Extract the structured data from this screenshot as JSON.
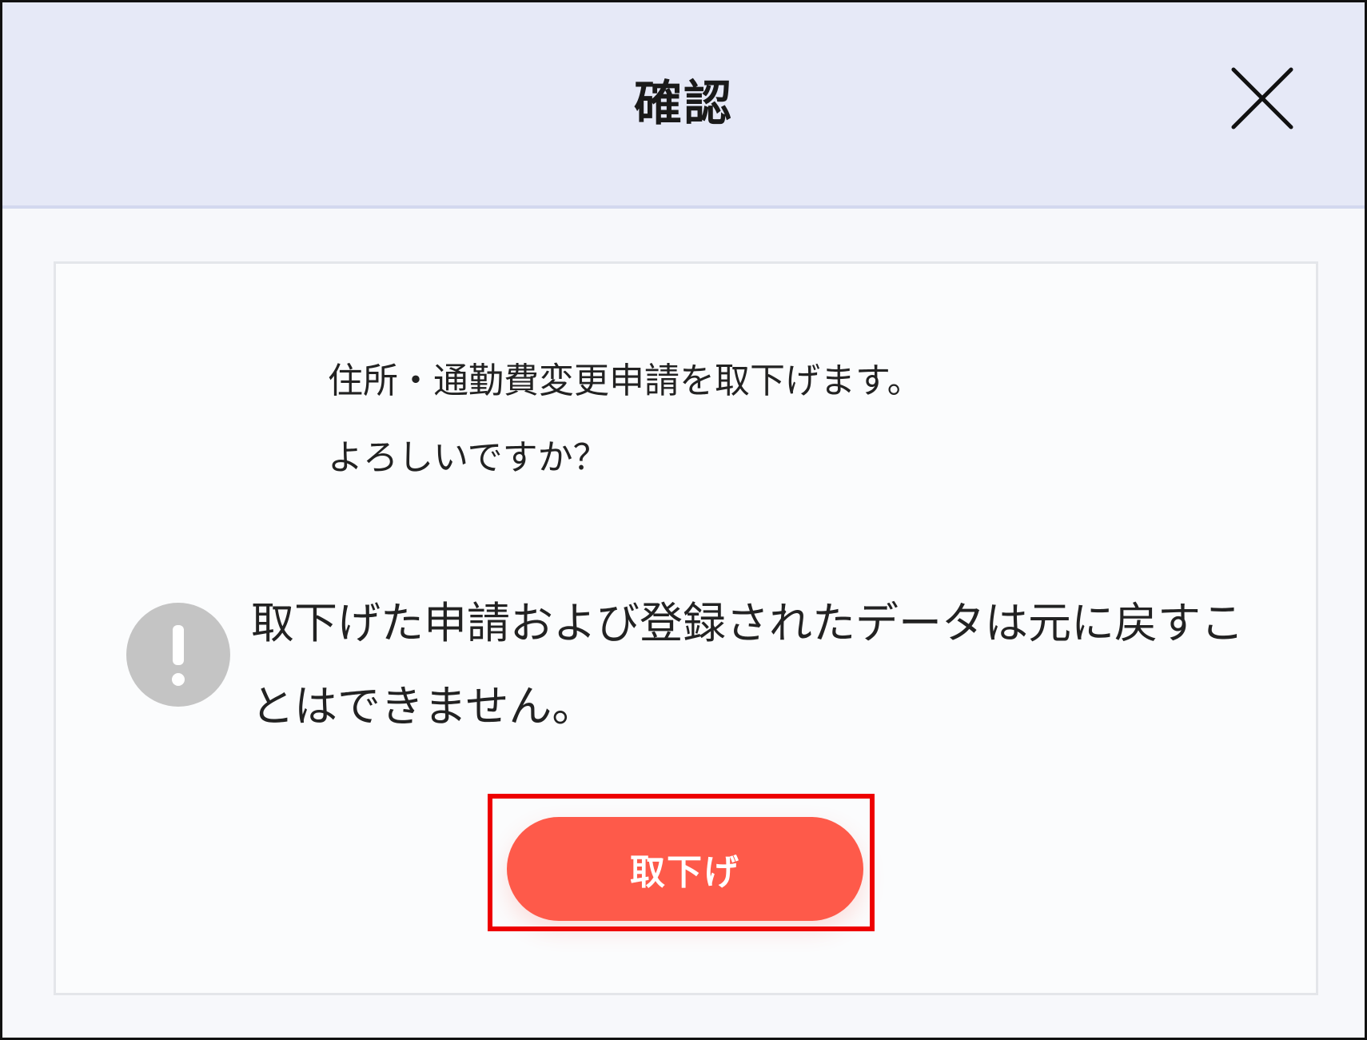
{
  "dialog": {
    "title": "確認",
    "close_icon": "close-icon"
  },
  "content": {
    "message_line1": "住所・通勤費変更申請を取下げます。",
    "message_line2": "よろしいですか？",
    "warning_icon": "exclamation-circle-icon",
    "warning_text": "取下げた申請および登録されたデータは元に戻すことはできません。"
  },
  "actions": {
    "withdraw_label": "取下げ"
  },
  "colors": {
    "header_bg": "#e6e9f7",
    "button_bg": "#fe5a4a",
    "highlight_border": "#ee0000",
    "warning_icon": "#c4c4c4"
  }
}
